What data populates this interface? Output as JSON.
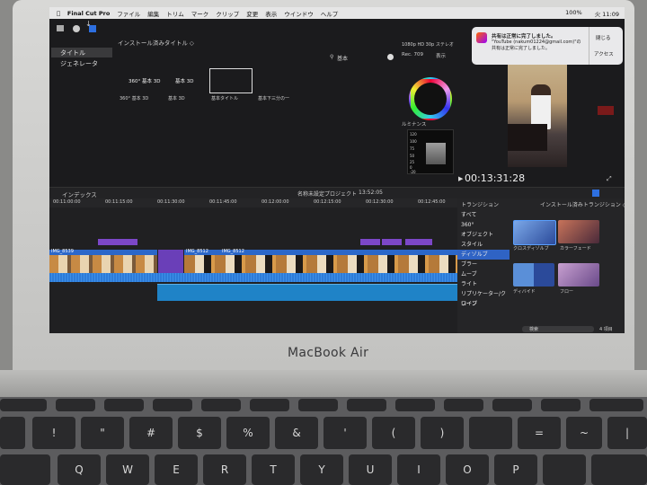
{
  "app": {
    "name": "Final Cut Pro"
  },
  "menubar": {
    "items": [
      "ファイル",
      "編集",
      "トリム",
      "マーク",
      "クリップ",
      "変更",
      "表示",
      "ウインドウ",
      "ヘルプ"
    ],
    "battery": "100%",
    "clock": "火 11:09"
  },
  "browser": {
    "title": "インストール済みタイトル ◇",
    "sidebar": [
      "タイトル",
      "ジェネレータ"
    ],
    "search_placeholder": "基本",
    "titles": [
      "360° 基本 3D",
      "基本 3D",
      "基本タイトル",
      "基本下三分の一"
    ]
  },
  "viewer": {
    "format": "1080p HD 30p ステレオ",
    "color": "Rec. 709",
    "display": "表示",
    "scope_label": "ルミナンス",
    "scope_ticks": [
      "120",
      "100",
      "75",
      "50",
      "25",
      "0",
      "-20"
    ],
    "timecode": "00:13:31:28"
  },
  "notification": {
    "title": "共有は正常に完了しました。",
    "body": "\"YouTube (nakum01224@gmail.com)\"の共有は正常に完了しました。",
    "close": "閉じる",
    "access": "アクセス"
  },
  "timeline": {
    "index_label": "インデックス",
    "project": "名称未設定プロジェクト",
    "duration": "13:52:05",
    "ruler": [
      "00:11:00:00",
      "00:11:15:00",
      "00:11:30:00",
      "00:11:45:00",
      "00:12:00:00",
      "00:12:15:00",
      "00:12:30:00",
      "00:12:45:00"
    ],
    "clip_labels": [
      "IMG_8539",
      "IMG_8512",
      "IMG_8512"
    ]
  },
  "transitions": {
    "header": "トランジション",
    "installed": "インストール済みトランジション ◇",
    "categories": [
      "すべて",
      "360°",
      "オブジェクト",
      "スタイル",
      "ディゾルブ",
      "ブラー",
      "ムーブ",
      "ライト",
      "リプリケーター/クローン",
      "ワイプ"
    ],
    "selected_index": 4,
    "items": [
      "クロスディゾルブ",
      "カラーフェード",
      "ディバイド",
      "フロー"
    ],
    "search_placeholder": "検索",
    "count": "4 項目"
  },
  "laptop": {
    "brand": "MacBook Air"
  },
  "keys": [
    "!",
    "\"",
    "#",
    "$",
    "%",
    "&",
    "'",
    "(",
    ")",
    "",
    "=",
    "~",
    "|",
    "Q",
    "W",
    "E",
    "R",
    "T",
    "Y",
    "U",
    "I",
    "O",
    "P"
  ]
}
